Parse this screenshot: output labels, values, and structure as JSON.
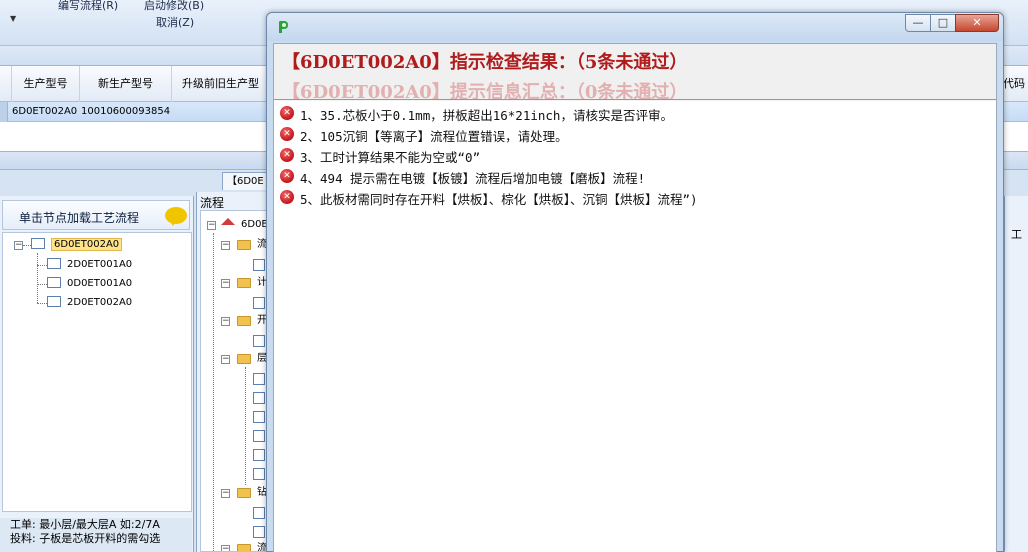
{
  "ribbon": {
    "edit_flow": "编写流程(R)",
    "start_modify": "启动修改(B)",
    "cancel": "取消(Z)"
  },
  "grid": {
    "columns": [
      "生产型号",
      "新生产型号",
      "升级前旧生产型",
      "代码"
    ],
    "row": {
      "model": "6D0ET002A0",
      "new_model": "10010600093854"
    }
  },
  "tab_stub": "【6D0E",
  "left_panel": {
    "header": "单击节点加载工艺流程",
    "tree": [
      {
        "label": "6D0ET002A0",
        "selected": true
      },
      {
        "label": "2D0ET001A0"
      },
      {
        "label": "0D0ET001A0"
      },
      {
        "label": "2D0ET002A0"
      }
    ],
    "notes": [
      "工单: 最小层/最大层A 如:2/7A",
      "投料: 子板是芯板开料的需勾选"
    ]
  },
  "mid_panel": {
    "header": "流程",
    "root": "6D0E",
    "folder_labels": [
      "流",
      "计",
      "开",
      "层",
      "钻",
      "流"
    ]
  },
  "right_strip": {
    "label": "工"
  },
  "dialog": {
    "heading": "【6D0ET002A0】指示检查结果：（5条未通过）",
    "heading_ghost": "【6D0ET002A0】提示信息汇总：（0条未通过）",
    "messages": [
      "1、35.芯板小于0.1mm，拼板超出16*21inch，请核实是否评审。",
      "2、105沉铜【等离子】流程位置错误，请处理。",
      "3、工时计算结果不能为空或“0”",
      "4、494 提示需在电镀【板镀】流程后增加电镀【磨板】流程!",
      "5、此板材需同时存在开料【烘板】、棕化【烘板】、沉铜【烘板】流程”)"
    ],
    "buttons": {
      "minimize": "—",
      "restore": "□",
      "close": "✕"
    }
  },
  "colors": {
    "heading_red": "#b01c1c",
    "error_red": "#c4141a",
    "selection": "#ffe38a"
  }
}
